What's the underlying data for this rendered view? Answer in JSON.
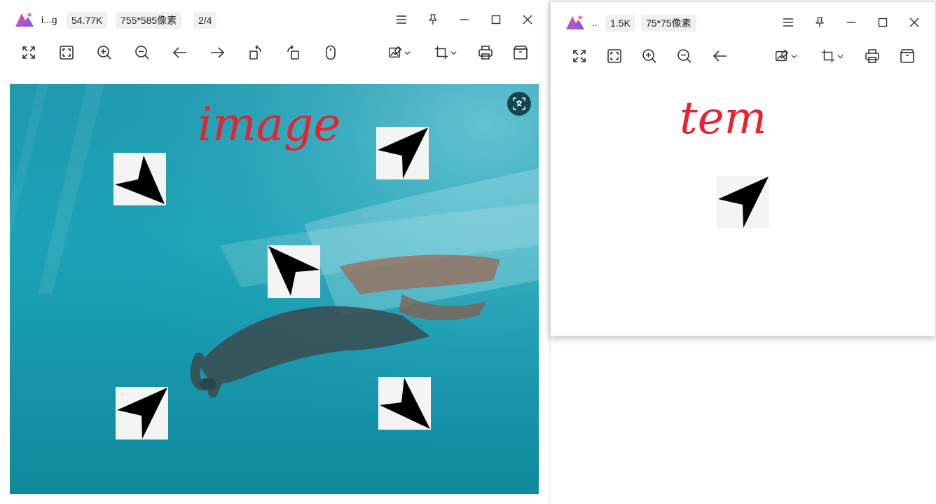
{
  "left_window": {
    "title": "i...g",
    "file_size": "54.77K",
    "dimensions": "755*585像素",
    "page_counter": "2/4",
    "image": {
      "annotation_text": "image",
      "annotation_color": "#e8222f",
      "water_color": "#1ba2b6"
    }
  },
  "right_window": {
    "title": "..",
    "file_size": "1.5K",
    "dimensions": "75*75像素",
    "image": {
      "annotation_text": "tem",
      "annotation_color": "#e8222f"
    }
  },
  "icons": {
    "titlebar": [
      "menu-icon",
      "pin-icon",
      "minimize-icon",
      "maximize-icon",
      "close-icon"
    ],
    "toolbar_left": [
      "fullscreen-icon",
      "fit-window-icon",
      "zoom-in-icon",
      "zoom-out-icon",
      "previous-icon",
      "next-icon",
      "rotate-left-icon",
      "rotate-right-icon",
      "mouse-icon",
      "edit-image-icon",
      "crop-icon",
      "print-icon",
      "archive-icon"
    ],
    "toolbar_right": [
      "fullscreen-icon",
      "fit-window-icon",
      "zoom-in-icon",
      "zoom-out-icon",
      "previous-icon",
      "edit-image-icon",
      "crop-icon",
      "print-icon",
      "archive-icon"
    ],
    "overlay": [
      "ocr-translate-icon"
    ]
  },
  "colors": {
    "chip_bg": "#f0f0f0",
    "logo_gradient": [
      "#ff4f7a",
      "#6a5cff"
    ]
  }
}
